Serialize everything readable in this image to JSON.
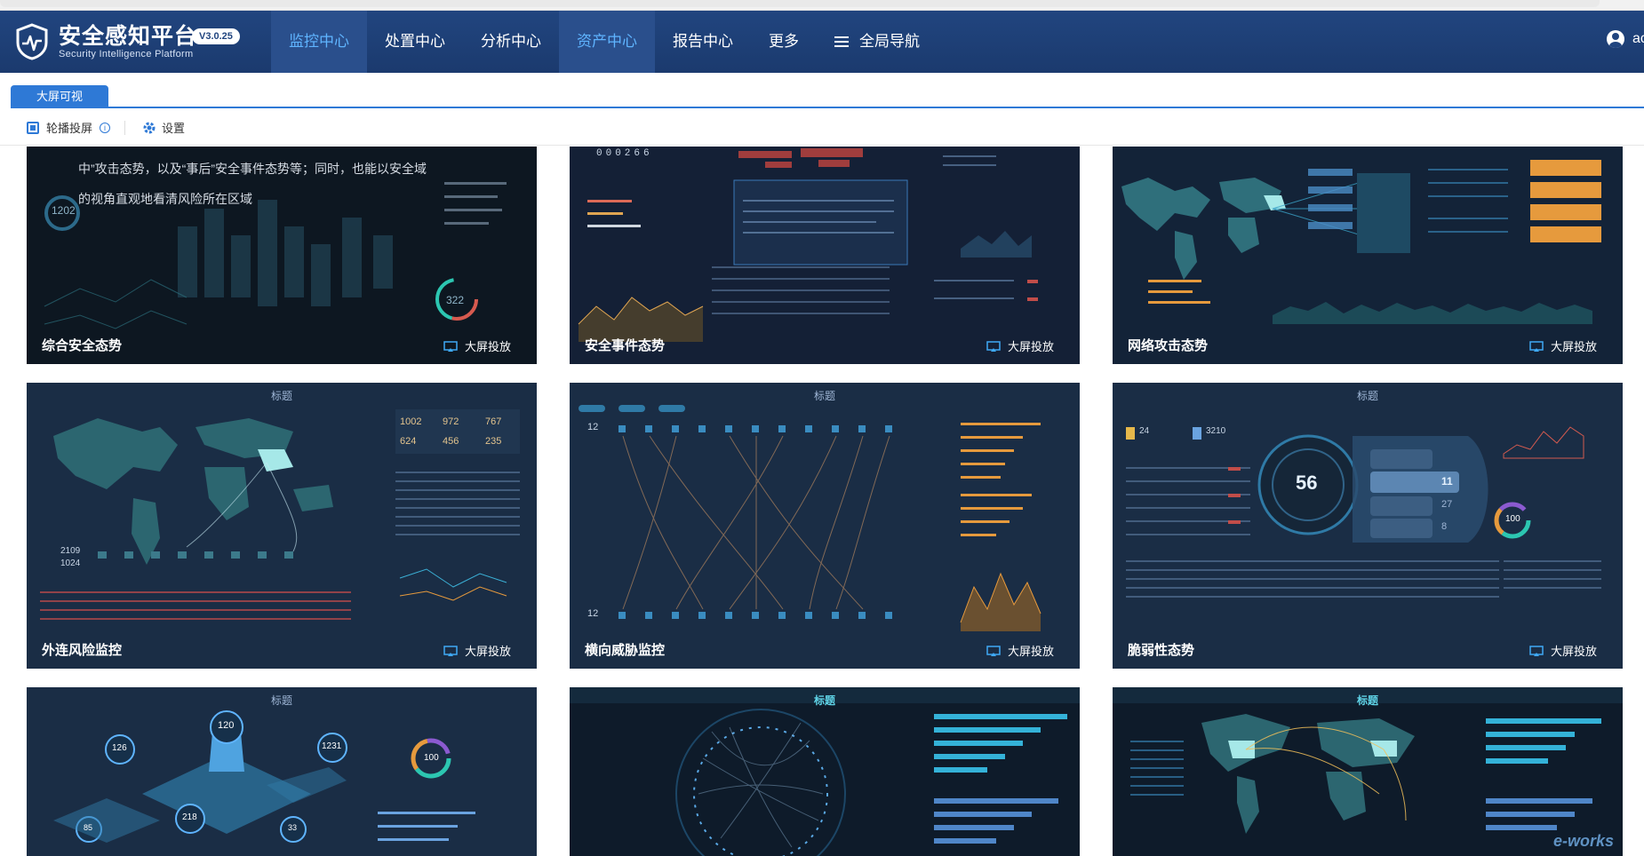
{
  "app": {
    "title": "安全感知平台",
    "subtitle": "Security Intelligence Platform",
    "version": "V3.0.25"
  },
  "nav": {
    "items": [
      "监控中心",
      "处置中心",
      "分析中心",
      "资产中心",
      "报告中心",
      "更多"
    ],
    "global_nav": "全局导航",
    "active_index": 0,
    "highlight_index": 3
  },
  "user": {
    "name": "ac"
  },
  "tabs": [
    {
      "label": "大屏可视"
    }
  ],
  "toolbar": {
    "rotate_label": "轮播投屏",
    "settings_label": "设置"
  },
  "cards": [
    {
      "title": "综合安全态势",
      "button": "大屏投放",
      "overlay_text": [
        "中”攻击态势，以及“事后”安全事件态势等；同时，也能以安全域",
        "的视角直观地看清风险所在区域"
      ],
      "numbers": [
        "1202",
        "322"
      ]
    },
    {
      "title": "安全事件态势",
      "button": "大屏投放",
      "counter": "000266"
    },
    {
      "title": "网络攻击态势",
      "button": "大屏投放"
    },
    {
      "title": "外连风险监控",
      "button": "大屏投放",
      "header": "标题",
      "stats": [
        "1002",
        "972",
        "767",
        "624",
        "456",
        "235"
      ],
      "counts": [
        "2109",
        "1024"
      ]
    },
    {
      "title": "横向威胁监控",
      "button": "大屏投放",
      "header": "标题",
      "counts": [
        "12",
        "12"
      ]
    },
    {
      "title": "脆弱性态势",
      "button": "大屏投放",
      "header": "标题",
      "stats": [
        "24",
        "3210",
        "56",
        "11",
        "27",
        "8",
        "100"
      ]
    },
    {
      "title": "",
      "button": "",
      "header": "标题",
      "stats": [
        "120",
        "126",
        "1231",
        "218",
        "85",
        "33",
        "100"
      ]
    },
    {
      "title": "",
      "button": "",
      "header": "标题"
    },
    {
      "title": "",
      "button": "",
      "header": "标题"
    }
  ],
  "watermark": "e-works",
  "colors": {
    "header": "#1b3a6e",
    "accent": "#2e79d6",
    "nav_active": "#5fb4ff",
    "card_bg": "#0f1b2e"
  }
}
